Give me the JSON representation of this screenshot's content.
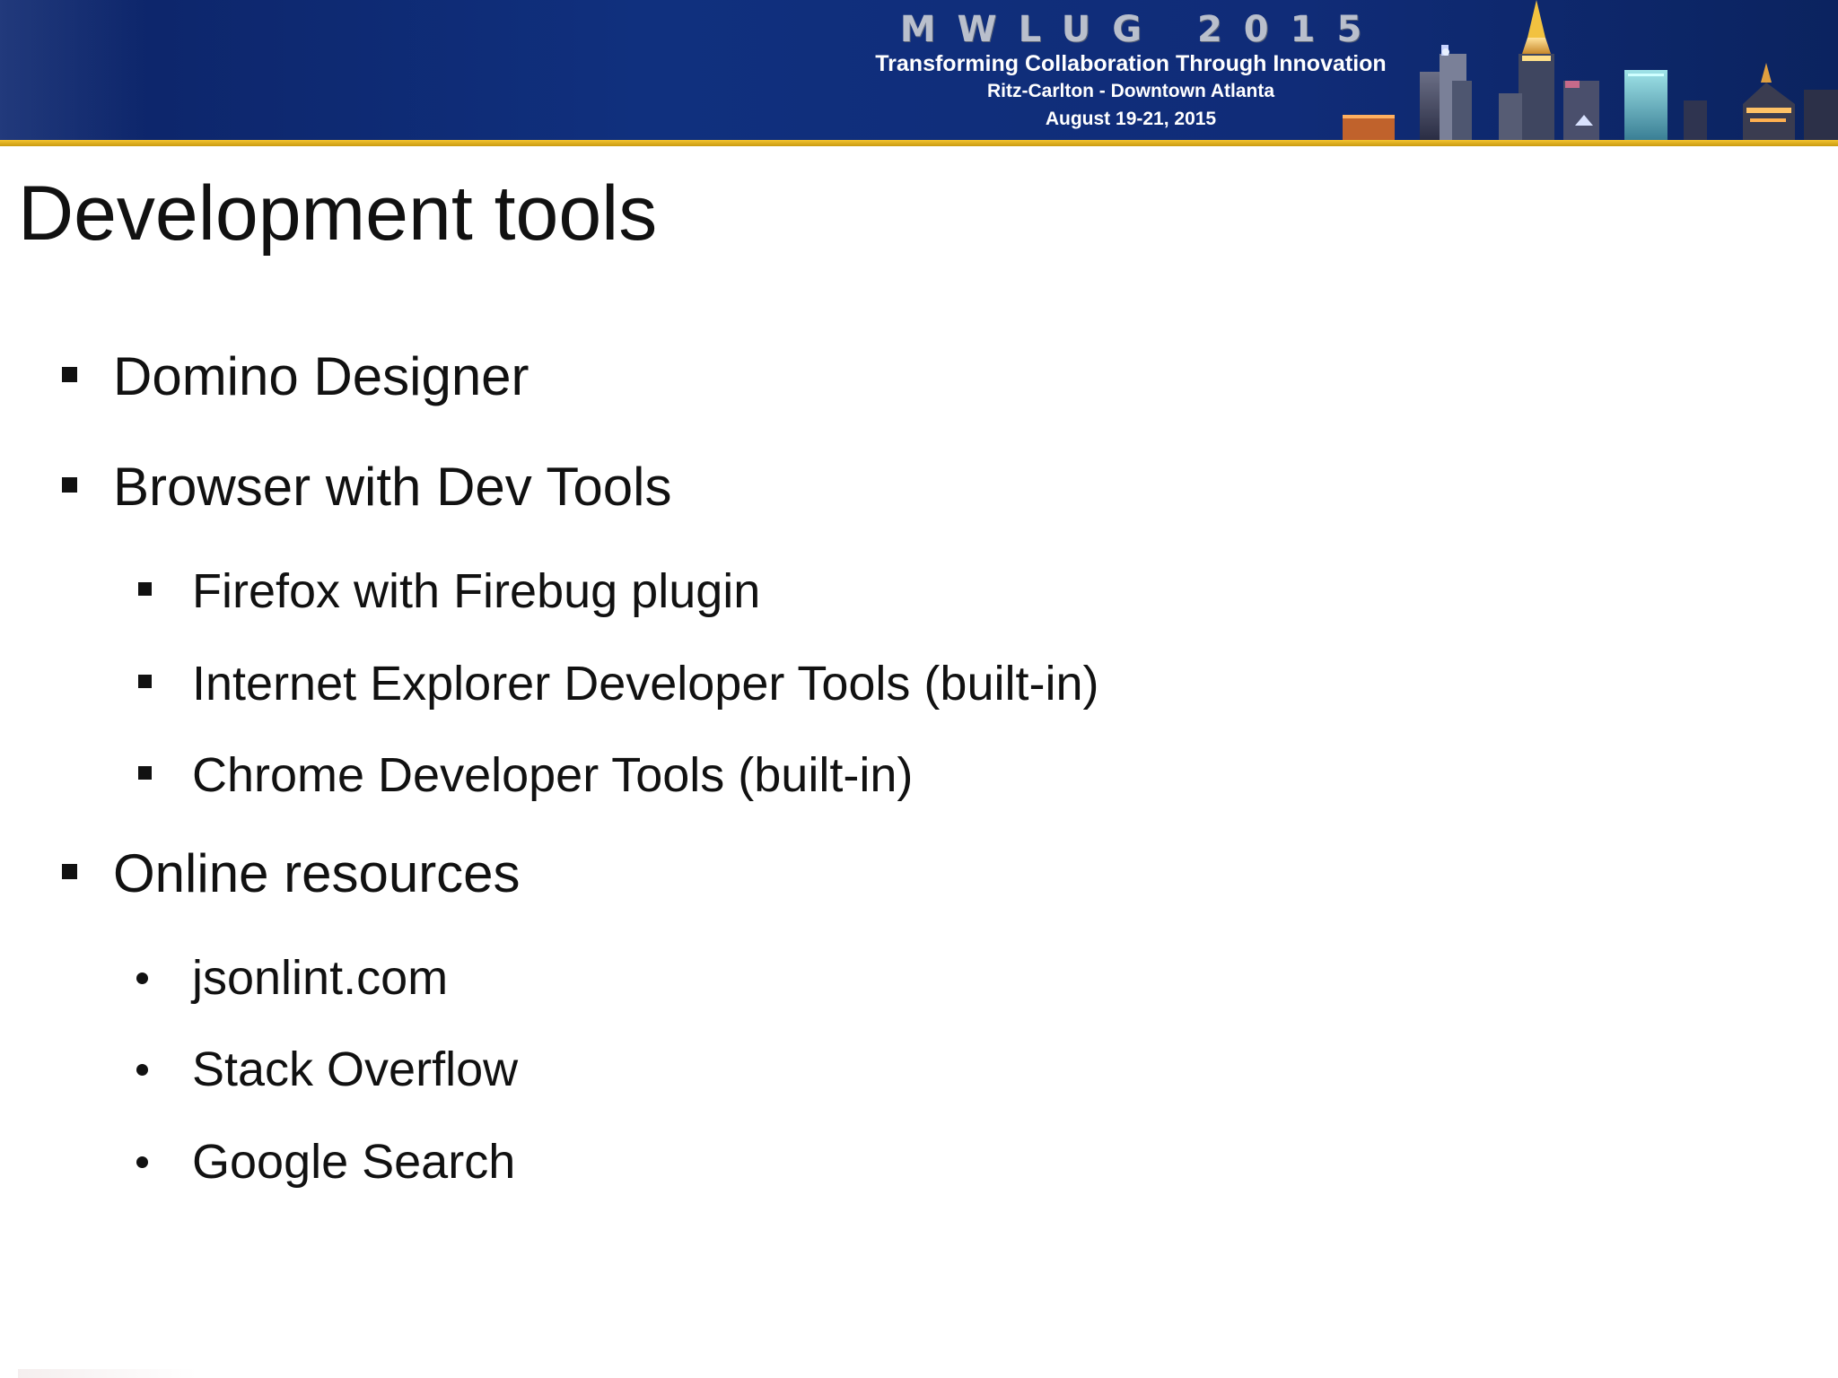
{
  "banner": {
    "event_title": "MWLUG 2015",
    "tagline": "Transforming Collaboration Through Innovation",
    "venue": "Ritz-Carlton - Downtown Atlanta",
    "dates": "August 19-21, 2015",
    "colors": {
      "background": "#10307e",
      "stripe": "#f4c430"
    }
  },
  "slide": {
    "title": "Development tools",
    "items": [
      {
        "level": 1,
        "marker": "square",
        "text": "Domino Designer"
      },
      {
        "level": 1,
        "marker": "square",
        "text": "Browser with Dev Tools"
      },
      {
        "level": 2,
        "marker": "square",
        "text": "Firefox with Firebug plugin"
      },
      {
        "level": 2,
        "marker": "square",
        "text": "Internet Explorer Developer Tools (built-in)"
      },
      {
        "level": 2,
        "marker": "square",
        "text": "Chrome Developer Tools (built-in)"
      },
      {
        "level": 1,
        "marker": "square",
        "text": "Online resources"
      },
      {
        "level": 2,
        "marker": "dot",
        "text": "jsonlint.com"
      },
      {
        "level": 2,
        "marker": "dot",
        "text": "Stack Overflow"
      },
      {
        "level": 2,
        "marker": "dot",
        "text": "Google Search"
      }
    ]
  }
}
